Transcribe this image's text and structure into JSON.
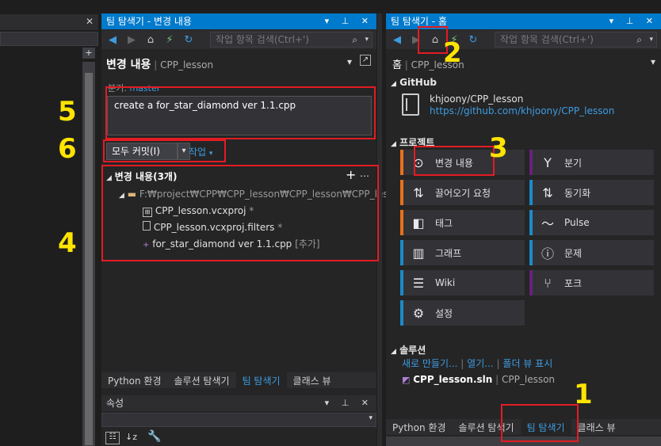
{
  "left_pane": {
    "title": "팀 탐색기 - 변경 내용",
    "title_buttons": "▾ ⊥ ✕"
  },
  "left_toolbar": {
    "search_placeholder": "작업 항목 검색(Ctrl+')"
  },
  "changes": {
    "heading": "변경 내용",
    "repo": "CPP_lesson",
    "branch_label": "분기:",
    "branch": "master",
    "commit_message": "create a for_star_diamond ver 1.1.cpp",
    "commit_all_label": "모두 커밋(I)",
    "actions_label": "작업",
    "list_header": "변경 내용(3개)",
    "path": "F:₩project₩CPP₩CPP_lesson₩CPP_lesson₩CPP_les...",
    "files": [
      {
        "name": "CPP_lesson.vcxproj",
        "suffix": "*"
      },
      {
        "name": "CPP_lesson.vcxproj.filters",
        "suffix": "*"
      },
      {
        "name": "for_star_diamond ver 1.1.cpp",
        "suffix": "[추가]"
      }
    ]
  },
  "left_tabs": [
    "Python 환경",
    "솔루션 탐색기",
    "팀 탐색기",
    "클래스 뷰"
  ],
  "properties": {
    "title": "속성"
  },
  "right_pane": {
    "title": "팀 탐색기 - 홈",
    "title_buttons": "▾ ⊥ ✕"
  },
  "right_toolbar": {
    "search_placeholder": "작업 항목 검색(Ctrl+')"
  },
  "home": {
    "heading": "홈",
    "repo": "CPP_lesson",
    "github_label": "GitHub",
    "github_repo": "khjoony/CPP_lesson",
    "github_url": "https://github.com/khjoony/CPP_lesson",
    "project_label": "프로젝트",
    "tiles": [
      {
        "label": "변경 내용",
        "color": "#e8711c"
      },
      {
        "label": "분기",
        "color": "#68217a"
      },
      {
        "label": "끌어오기 요청",
        "color": "#e8711c"
      },
      {
        "label": "동기화",
        "color": "#1c8ac9"
      },
      {
        "label": "태그",
        "color": "#e8711c"
      },
      {
        "label": "Pulse",
        "color": "#1c8ac9"
      },
      {
        "label": "그래프",
        "color": "#1c8ac9"
      },
      {
        "label": "문제",
        "color": "#1c8ac9"
      },
      {
        "label": "Wiki",
        "color": "#1c8ac9"
      },
      {
        "label": "포크",
        "color": "#68217a"
      },
      {
        "label": "설정",
        "color": "#1c8ac9"
      }
    ],
    "solution_label": "솔루션",
    "solution_links": [
      "새로 만들기...",
      "열기...",
      "폴더 뷰 표시"
    ],
    "solution_file": "CPP_lesson.sln",
    "solution_repo": "CPP_lesson"
  },
  "right_tabs": [
    "Python 환경",
    "솔루션 탐색기",
    "팀 탐색기",
    "클래스 뷰"
  ],
  "annotations": [
    "1",
    "2",
    "3",
    "4",
    "5",
    "6"
  ],
  "colors": {
    "accent": "#007acc",
    "link": "#3d9ce0",
    "annotation_box": "#e41b23",
    "annotation_number": "#ffe400"
  }
}
